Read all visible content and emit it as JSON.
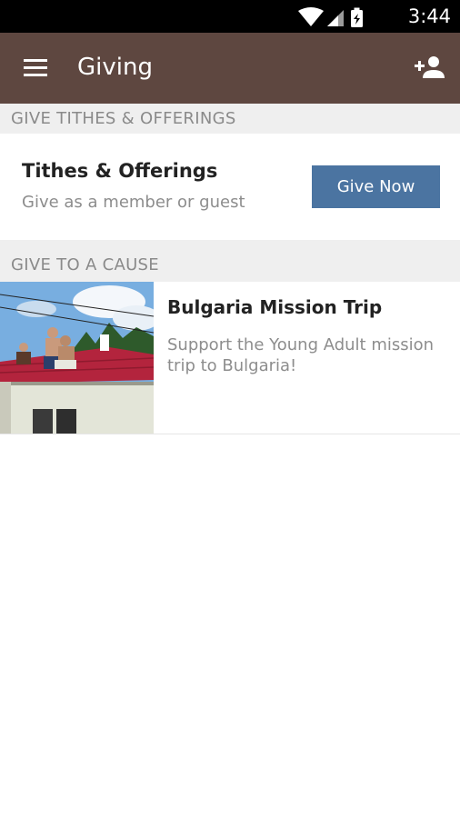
{
  "status_bar": {
    "time": "3:44",
    "icons": [
      "wifi-icon",
      "cell-signal-icon",
      "battery-charging-icon"
    ]
  },
  "app_bar": {
    "title": "Giving",
    "menu_icon": "hamburger-menu-icon",
    "action_icon": "add-user-icon",
    "background": "#5e4740"
  },
  "sections": {
    "tithes_header": "GIVE TITHES & OFFERINGS",
    "cause_header": "GIVE TO A CAUSE"
  },
  "tithes": {
    "title": "Tithes & Offerings",
    "subtitle": "Give as a member or guest",
    "button_label": "Give Now",
    "button_color": "#4b74a1"
  },
  "causes": [
    {
      "title": "Bulgaria Mission Trip",
      "description": "Support the Young Adult mission trip to Bulgaria!"
    }
  ]
}
